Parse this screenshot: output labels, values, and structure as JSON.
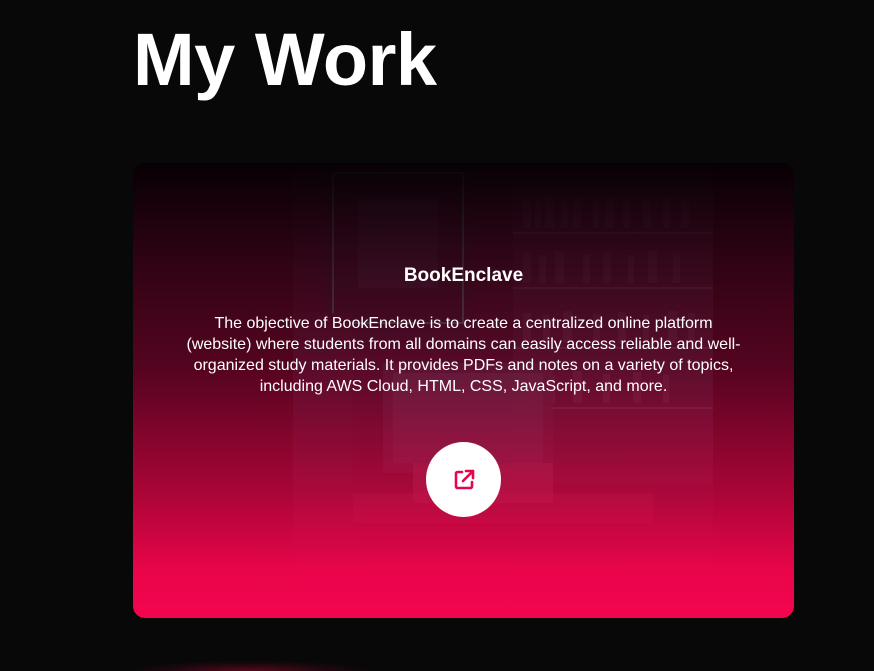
{
  "section": {
    "heading": "My Work"
  },
  "project_card": {
    "title": "BookEnclave",
    "description": "The objective of BookEnclave is to create a centralized online platform (website) where students from all domains can easily access reliable and well-organized study materials. It provides PDFs and notes on a variety of topics, including AWS Cloud, HTML, CSS, JavaScript, and more.",
    "link_icon": "external-link-icon",
    "background_image": "library-scene",
    "colors": {
      "accent": "#f3054f",
      "page_background": "#080808",
      "button_background": "#ffffff"
    }
  }
}
